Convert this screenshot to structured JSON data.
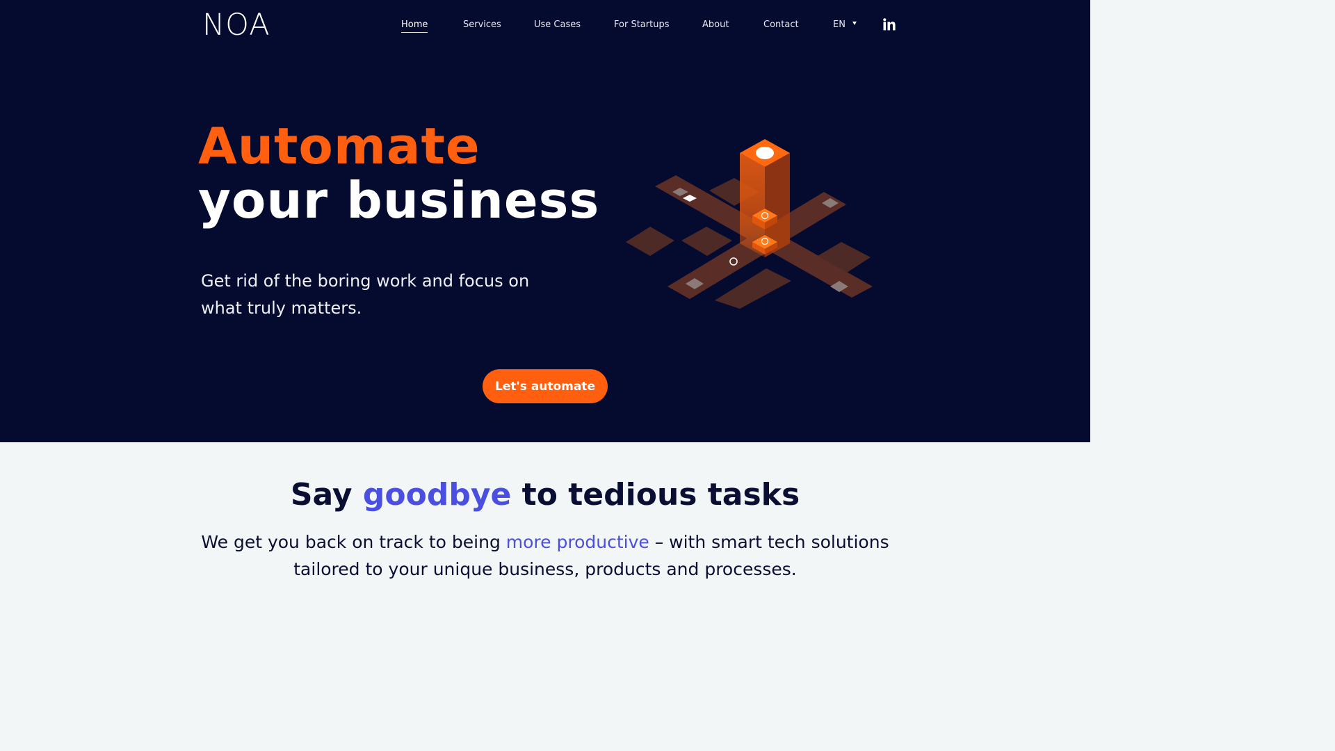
{
  "nav": {
    "logo": "NOA",
    "links": [
      {
        "label": "Home",
        "active": true
      },
      {
        "label": "Services"
      },
      {
        "label": "Use Cases"
      },
      {
        "label": "For Startups"
      },
      {
        "label": "About"
      },
      {
        "label": "Contact"
      }
    ],
    "language": "EN",
    "social_icon": "linkedin-icon"
  },
  "hero": {
    "title_line1": "Automate",
    "title_line2": "your business",
    "subtitle_line1": "Get rid of the boring work and focus on",
    "subtitle_line2": "what truly matters.",
    "cta_label": "Let's automate",
    "illustration_icon": "isometric-automation-platform-icon"
  },
  "intro": {
    "title_part1": "Say ",
    "title_accent": "goodbye",
    "title_part2": " to tedious tasks",
    "text_part1": "We get you back on track to being ",
    "text_accent": "more productive",
    "text_part2": " – with smart tech solutions",
    "text_line2": "tailored to your unique business, products and processes."
  },
  "colors": {
    "hero_bg": "#050a2f",
    "accent_orange": "#ff5f0f",
    "accent_blue": "#4a4fe0",
    "section_bg": "#f3f6f7",
    "dark_text": "#0b0e33"
  }
}
